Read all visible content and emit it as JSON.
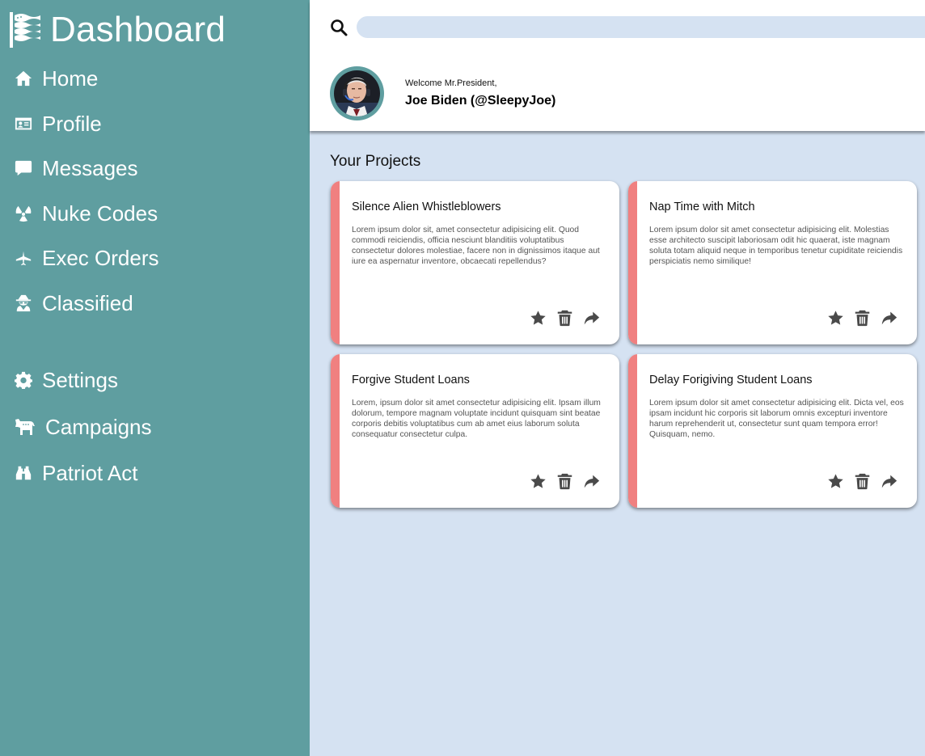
{
  "sidebar": {
    "brand_title": "Dashboard",
    "items": [
      {
        "label": "Home",
        "icon": "home-icon"
      },
      {
        "label": "Profile",
        "icon": "id-card-icon"
      },
      {
        "label": "Messages",
        "icon": "message-icon"
      },
      {
        "label": "Nuke Codes",
        "icon": "radiation-icon"
      },
      {
        "label": "Exec Orders",
        "icon": "fighter-jet-icon"
      },
      {
        "label": "Classified",
        "icon": "user-secret-icon"
      },
      {
        "label": "Settings",
        "icon": "gear-icon"
      },
      {
        "label": "Campaigns",
        "icon": "donkey-icon"
      },
      {
        "label": "Patriot Act",
        "icon": "binoculars-icon"
      }
    ]
  },
  "header": {
    "search_placeholder": "",
    "welcome": "Welcome Mr.President,",
    "user_name": "Joe Biden (@SleepyJoe)"
  },
  "main": {
    "section_title": "Your Projects",
    "projects": [
      {
        "title": "Silence Alien Whistleblowers",
        "body": "Lorem ipsum dolor sit, amet consectetur adipisicing elit. Quod commodi reiciendis, officia nesciunt blanditiis voluptatibus consectetur dolores molestiae, facere non in dignissimos itaque aut iure ea aspernatur inventore, obcaecati repellendus?"
      },
      {
        "title": "Nap Time with Mitch",
        "body": "Lorem ipsum dolor sit amet consectetur adipisicing elit. Molestias esse architecto suscipit laboriosam odit hic quaerat, iste magnam soluta totam aliquid neque in temporibus tenetur cupiditate reiciendis perspiciatis nemo similique!"
      },
      {
        "title": "Forgive Student Loans",
        "body": "Lorem, ipsum dolor sit amet consectetur adipisicing elit. Ipsam illum dolorum, tempore magnam voluptate incidunt quisquam sint beatae corporis debitis voluptatibus cum ab amet eius laborum soluta consequatur consectetur culpa."
      },
      {
        "title": "Delay Forigiving Student Loans",
        "body": "Lorem ipsum dolor sit amet consectetur adipisicing elit. Dicta vel, eos ipsam incidunt hic corporis sit laborum omnis excepturi inventore harum reprehenderit ut, consectetur sunt quam tempora error! Quisquam, nemo."
      }
    ]
  },
  "colors": {
    "sidebar": "#5f9ea0",
    "background": "#d5e2f2",
    "card_accent": "#f08080",
    "icon_gray": "#4a4a4a"
  }
}
